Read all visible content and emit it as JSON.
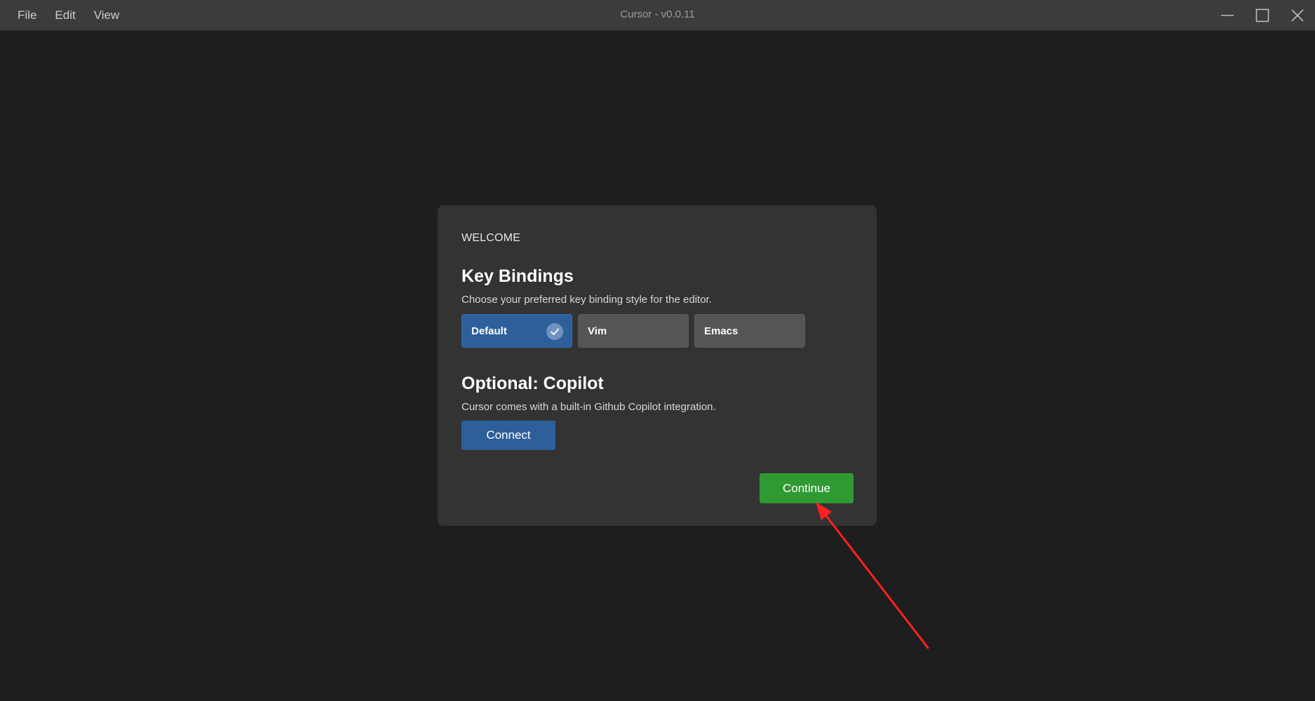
{
  "window": {
    "title": "Cursor - v0.0.11"
  },
  "menu": {
    "items": [
      {
        "label": "File"
      },
      {
        "label": "Edit"
      },
      {
        "label": "View"
      }
    ]
  },
  "dialog": {
    "welcome": "WELCOME",
    "key_bindings": {
      "heading": "Key Bindings",
      "description": "Choose your preferred key binding style for the editor.",
      "options": [
        {
          "label": "Default",
          "selected": true
        },
        {
          "label": "Vim",
          "selected": false
        },
        {
          "label": "Emacs",
          "selected": false
        }
      ]
    },
    "copilot": {
      "heading": "Optional: Copilot",
      "description": "Cursor comes with a built-in Github Copilot integration.",
      "connect_label": "Connect"
    },
    "continue_label": "Continue"
  },
  "icons": {
    "minimize": "minimize-icon",
    "maximize": "maximize-icon",
    "close": "close-icon",
    "check": "check-icon",
    "annotation_arrow": "red-arrow"
  },
  "colors": {
    "background": "#1e1e1e",
    "titlebar": "#3c3c3c",
    "dialog": "#333333",
    "selected_option": "#2d5f9a",
    "option": "#555555",
    "connect": "#2d5f9a",
    "continue": "#2f9a33",
    "annotation": "#ff2020"
  }
}
